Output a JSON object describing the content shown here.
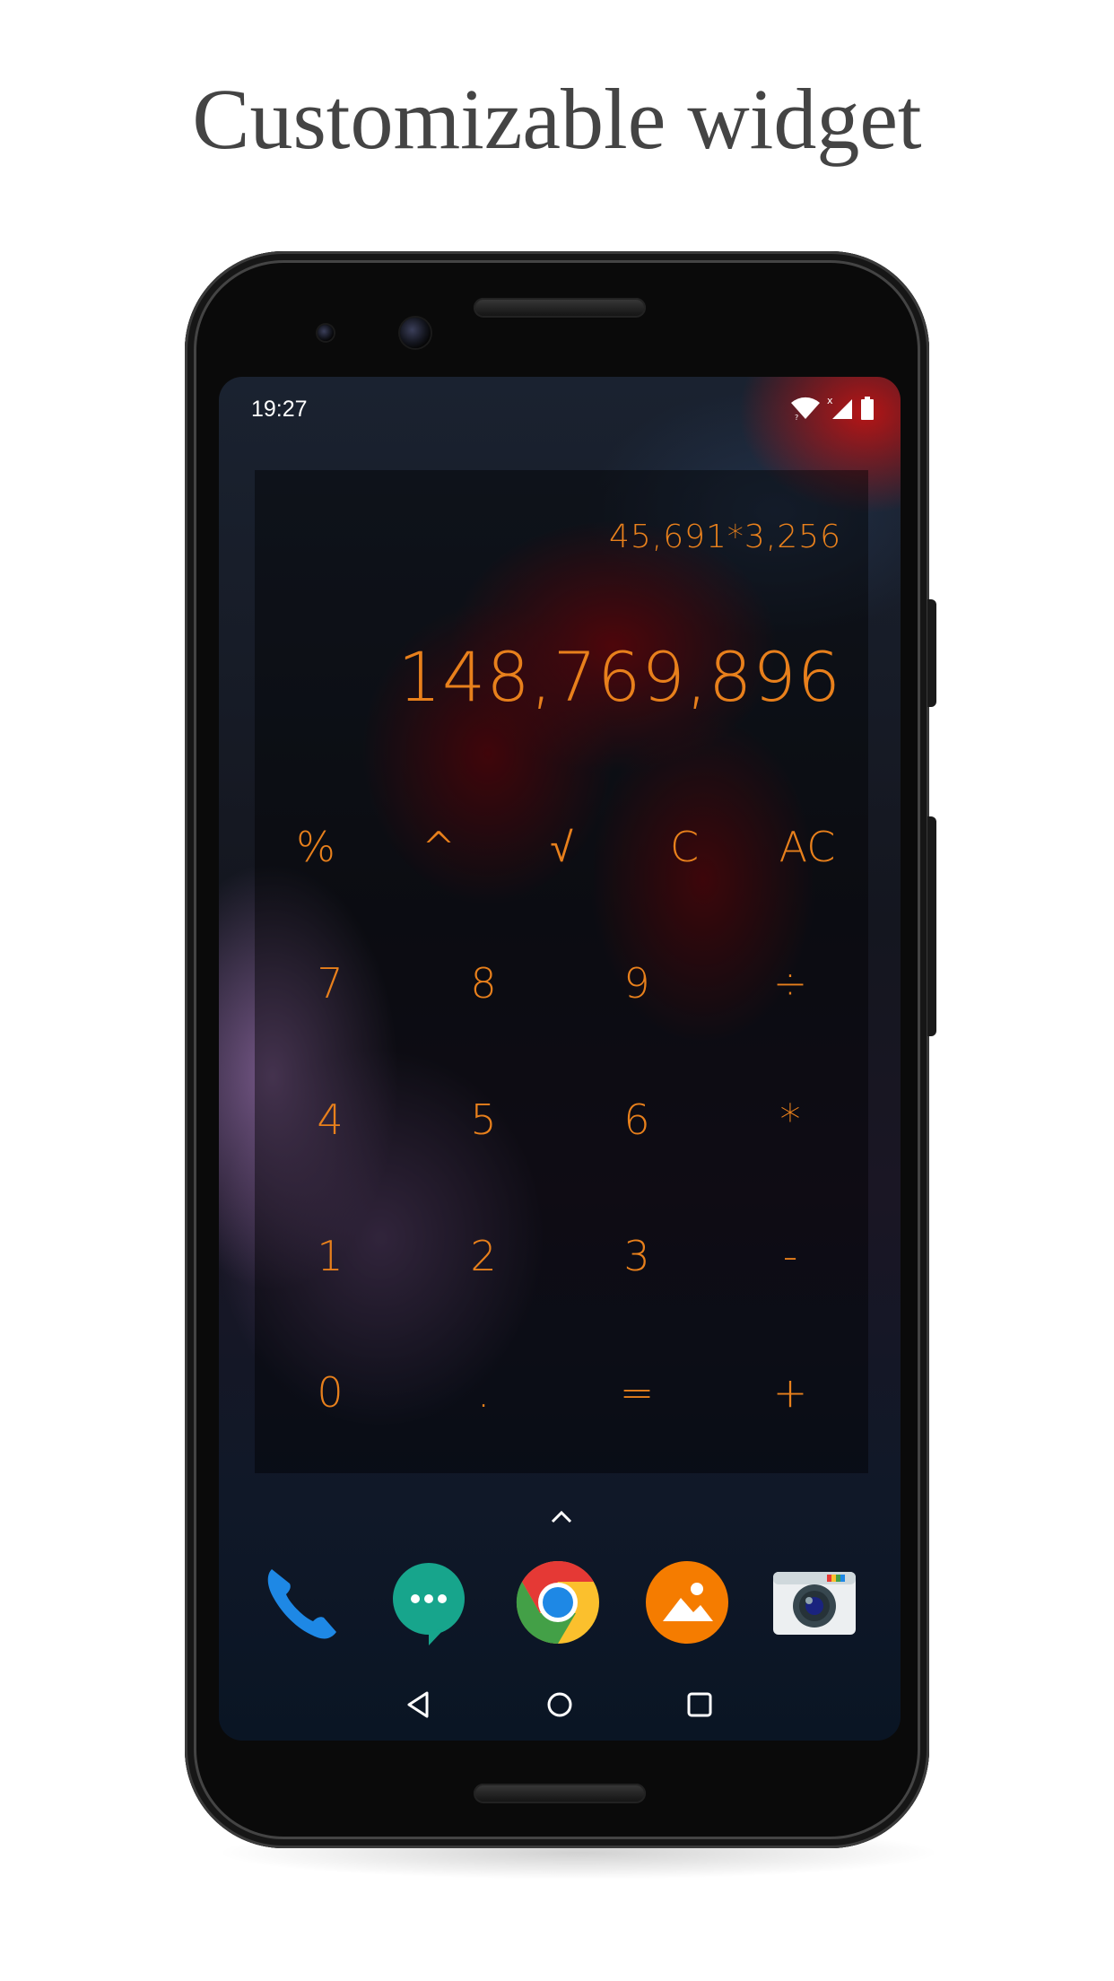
{
  "headline": "Customizable widget",
  "status_bar": {
    "time": "19:27",
    "icons": [
      "wifi-icon",
      "cell-signal-icon",
      "battery-icon"
    ]
  },
  "widget": {
    "expression": "45,691*3,256",
    "result": "148,769,896",
    "accent_color": "#e8801c",
    "keys": [
      [
        "%",
        "^",
        "√",
        "C",
        "AC"
      ],
      [
        "7",
        "8",
        "9",
        "÷"
      ],
      [
        "4",
        "5",
        "6",
        "*"
      ],
      [
        "1",
        "2",
        "3",
        "-"
      ],
      [
        "0",
        ".",
        "=",
        "+"
      ]
    ]
  },
  "dock": {
    "apps": [
      "phone-icon",
      "messages-icon",
      "chrome-icon",
      "gallery-icon",
      "camera-icon"
    ]
  },
  "nav_bar": {
    "buttons": [
      "back-icon",
      "home-icon",
      "recents-icon"
    ]
  }
}
